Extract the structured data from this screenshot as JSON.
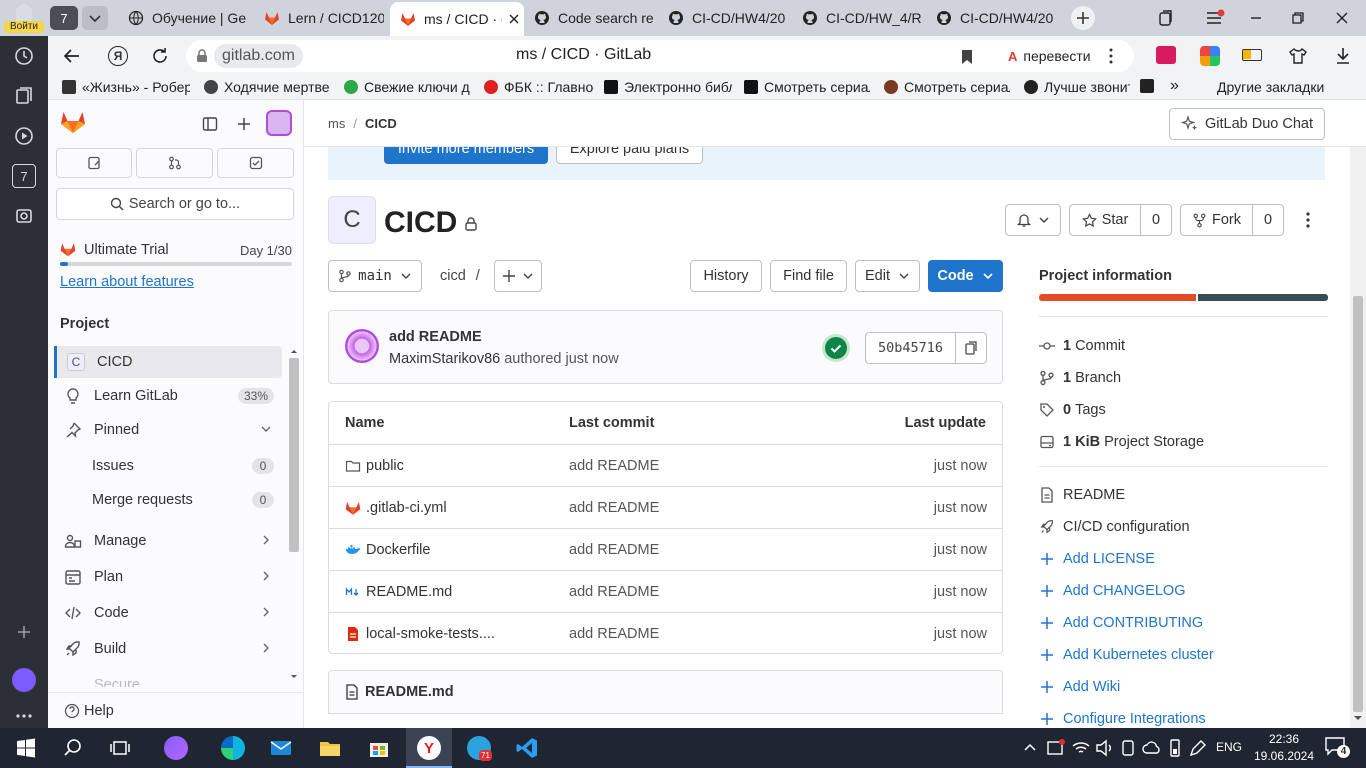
{
  "browser": {
    "profile_label": "Войти",
    "tab_group_count": "7",
    "tabs": [
      {
        "title": "Обучение | Ge",
        "icon": "globe-icon"
      },
      {
        "title": "Lern / CICD120",
        "icon": "gitlab-icon"
      },
      {
        "title": "ms / CICD · G",
        "icon": "gitlab-icon",
        "active": true
      },
      {
        "title": "Code search re",
        "icon": "github-icon"
      },
      {
        "title": "CI-CD/HW4/20",
        "icon": "github-icon"
      },
      {
        "title": "CI-CD/HW_4/R",
        "icon": "github-icon"
      },
      {
        "title": "CI-CD/HW4/20",
        "icon": "github-icon"
      }
    ],
    "address_domain": "gitlab.com",
    "address_title": "ms / CICD · GitLab",
    "translate_label": "перевести",
    "bookmarks": [
      {
        "label": "«Жизнь» - Роберт",
        "icon_color": "#333333"
      },
      {
        "label": "Ходячие мертвец",
        "icon_color": "#444444"
      },
      {
        "label": "Свежие ключи дл",
        "icon_color": "#2aa84a"
      },
      {
        "label": "ФБК :: Главное",
        "icon_color": "#e02020"
      },
      {
        "label": "Электронно библ",
        "icon_color": "#111111"
      },
      {
        "label": "Смотреть сериал",
        "icon_color": "#111111"
      },
      {
        "label": "Смотреть сериал",
        "icon_color": "#7a3b1e"
      },
      {
        "label": "Лучше звонит",
        "icon_color": "#222222"
      }
    ],
    "bookmarks_more": "»",
    "other_bookmarks": "Другие закладки",
    "rail_badge": "7"
  },
  "sidebar": {
    "search_placeholder": "Search or go to...",
    "trial_title": "Ultimate Trial",
    "trial_day": "Day 1/30",
    "trial_progress": 0.033,
    "learn_link": "Learn about features",
    "section_title": "Project",
    "project_avatar_letter": "C",
    "project_name": "CICD",
    "learn_gitlab": "Learn GitLab",
    "learn_gitlab_pct": "33%",
    "pinned": "Pinned",
    "issues": "Issues",
    "issues_count": "0",
    "merge_requests": "Merge requests",
    "mr_count": "0",
    "manage": "Manage",
    "plan": "Plan",
    "code": "Code",
    "build": "Build",
    "secure": "Secure",
    "help": "Help"
  },
  "breadcrumb": {
    "group": "ms",
    "sep": "/",
    "project": "CICD"
  },
  "duo_chat": "GitLab Duo Chat",
  "banner": {
    "invite": "Invite more members",
    "explore": "Explore paid plans"
  },
  "project": {
    "avatar_letter": "C",
    "title": "CICD",
    "star_label": "Star",
    "star_count": "0",
    "fork_label": "Fork",
    "fork_count": "0"
  },
  "repo_toolbar": {
    "branch": "main",
    "path": "cicd",
    "path_sep": "/",
    "history": "History",
    "find_file": "Find file",
    "edit": "Edit",
    "code": "Code"
  },
  "commit": {
    "message": "add README",
    "author": "MaximStarikov86",
    "authored": "authored just now",
    "sha": "50b45716"
  },
  "files": {
    "headers": {
      "name": "Name",
      "last_commit": "Last commit",
      "last_update": "Last update"
    },
    "rows": [
      {
        "name": "public",
        "icon": "folder-icon",
        "commit": "add README",
        "updated": "just now"
      },
      {
        "name": ".gitlab-ci.yml",
        "icon": "gitlab-file-icon",
        "commit": "add README",
        "updated": "just now"
      },
      {
        "name": "Dockerfile",
        "icon": "docker-icon",
        "commit": "add README",
        "updated": "just now"
      },
      {
        "name": "README.md",
        "icon": "markdown-icon",
        "commit": "add README",
        "updated": "just now"
      },
      {
        "name": "local-smoke-tests....",
        "icon": "pdf-file-icon",
        "commit": "add README",
        "updated": "just now"
      }
    ]
  },
  "readme_card": "README.md",
  "project_info": {
    "title": "Project information",
    "commits_n": "1",
    "commits_label": "Commit",
    "branches_n": "1",
    "branches_label": "Branch",
    "tags_n": "0",
    "tags_label": "Tags",
    "storage_n": "1 KiB",
    "storage_label": "Project Storage",
    "readme": "README",
    "cicd": "CI/CD configuration",
    "add_license": "Add LICENSE",
    "add_changelog": "Add CHANGELOG",
    "add_contributing": "Add CONTRIBUTING",
    "add_k8s": "Add Kubernetes cluster",
    "add_wiki": "Add Wiki",
    "configure_integrations": "Configure Integrations"
  },
  "taskbar": {
    "language": "ENG",
    "time": "22:36",
    "date": "19.06.2024",
    "notifications": "4",
    "telegram_badge": "71"
  }
}
